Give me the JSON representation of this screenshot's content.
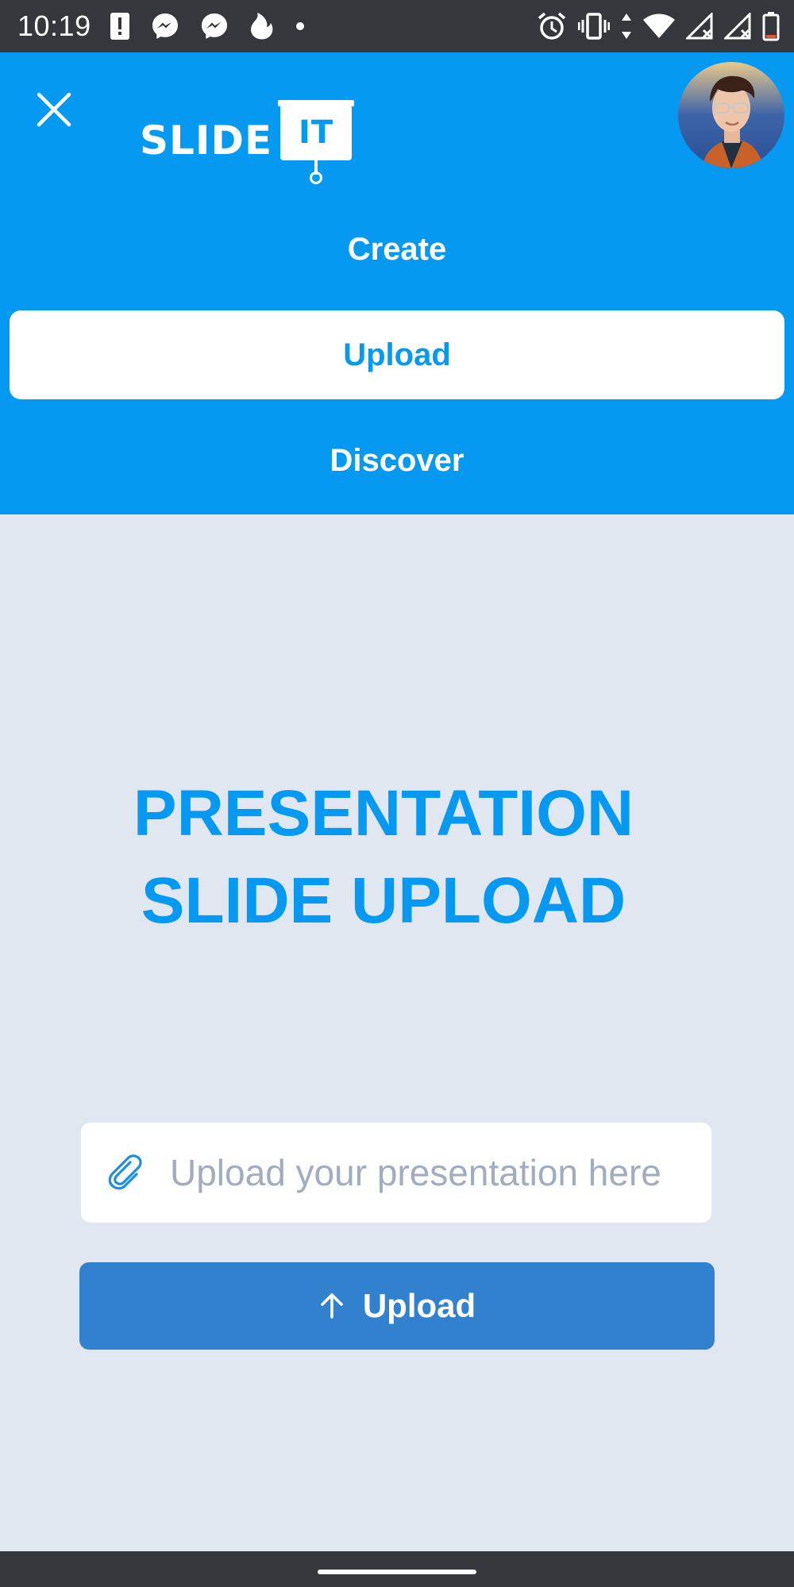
{
  "status_bar": {
    "time": "10:19",
    "left_icons": [
      "alert-icon",
      "messenger-icon",
      "messenger-icon",
      "tinder-flame-icon",
      "dot-icon"
    ],
    "right_icons": [
      "alarm-icon",
      "vibrate-icon",
      "data-arrows-icon",
      "wifi-icon",
      "signal-no-service-icon",
      "signal-no-service-icon",
      "battery-icon"
    ]
  },
  "header": {
    "logo_text": "SLIDE",
    "logo_board_text": "IT",
    "close_icon": "close-icon",
    "avatar": "user-avatar"
  },
  "nav": {
    "items": [
      {
        "label": "Create",
        "active": false
      },
      {
        "label": "Upload",
        "active": true
      },
      {
        "label": "Discover",
        "active": false
      }
    ]
  },
  "main": {
    "title_line1": "PRESENTATION",
    "title_line2": "SLIDE UPLOAD",
    "file_input": {
      "placeholder": "Upload your presentation here",
      "value": "",
      "icon": "paperclip-icon"
    },
    "upload_button": {
      "label": "Upload",
      "icon": "arrow-up-icon"
    }
  },
  "colors": {
    "brand_blue": "#0599f2",
    "button_blue": "#3281cf",
    "background": "#e1e7f0",
    "system_bar": "#35373c",
    "placeholder": "#a2acbe"
  }
}
